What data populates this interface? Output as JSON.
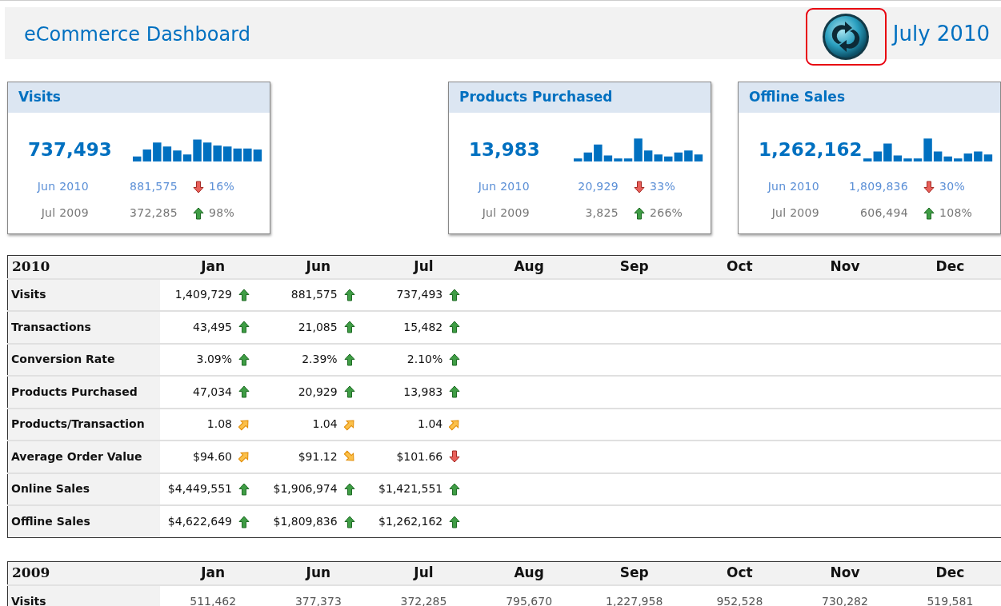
{
  "header": {
    "title": "eCommerce Dashboard",
    "refresh_highlighted": true,
    "period": "July 2010"
  },
  "cards": [
    {
      "title": "Visits",
      "value": "737,493",
      "comparisons": [
        {
          "color": "#5b8fd6",
          "label": "Jun 2010",
          "value": "881,575",
          "kind": "down",
          "change": "16%"
        },
        {
          "color": "#777777",
          "label": "Jul 2009",
          "value": "372,285",
          "kind": "up",
          "change": "98%"
        }
      ]
    },
    {
      "title": "Products Purchased",
      "value": "13,983",
      "comparisons": [
        {
          "color": "#5b8fd6",
          "label": "Jun 2010",
          "value": "20,929",
          "kind": "down",
          "change": "33%"
        },
        {
          "color": "#777777",
          "label": "Jul 2009",
          "value": "3,825",
          "kind": "up",
          "change": "266%"
        }
      ]
    },
    {
      "title": "Offline Sales",
      "value": "1,262,162",
      "comparisons": [
        {
          "color": "#5b8fd6",
          "label": "Jun 2010",
          "value": "1,809,836",
          "kind": "down",
          "change": "30%"
        },
        {
          "color": "#777777",
          "label": "Jul 2009",
          "value": "606,494",
          "kind": "up",
          "change": "108%"
        }
      ]
    }
  ],
  "tables": [
    {
      "year": "2010",
      "columns": [
        "Jan",
        "Jun",
        "Jul",
        "Aug",
        "Sep",
        "Oct",
        "Nov",
        "Dec"
      ],
      "rows": [
        {
          "label": "Visits",
          "cells": [
            {
              "value": "1,409,729",
              "kind": "up"
            },
            {
              "value": "881,575",
              "kind": "up"
            },
            {
              "value": "737,493",
              "kind": "up"
            }
          ]
        },
        {
          "label": "Transactions",
          "cells": [
            {
              "value": "43,495",
              "kind": "up"
            },
            {
              "value": "21,085",
              "kind": "up"
            },
            {
              "value": "15,482",
              "kind": "up"
            }
          ]
        },
        {
          "label": "Conversion Rate",
          "cells": [
            {
              "value": "3.09%",
              "kind": "up"
            },
            {
              "value": "2.39%",
              "kind": "up"
            },
            {
              "value": "2.10%",
              "kind": "up"
            }
          ]
        },
        {
          "label": "Products Purchased",
          "cells": [
            {
              "value": "47,034",
              "kind": "up"
            },
            {
              "value": "20,929",
              "kind": "up"
            },
            {
              "value": "13,983",
              "kind": "up"
            }
          ]
        },
        {
          "label": "Products/Transaction",
          "cells": [
            {
              "value": "1.08",
              "kind": "upright"
            },
            {
              "value": "1.04",
              "kind": "upright"
            },
            {
              "value": "1.04",
              "kind": "upright"
            }
          ]
        },
        {
          "label": "Average Order Value",
          "cells": [
            {
              "value": "$94.60",
              "kind": "upright"
            },
            {
              "value": "$91.12",
              "kind": "downright"
            },
            {
              "value": "$101.66",
              "kind": "down"
            }
          ]
        },
        {
          "label": "Online Sales",
          "cells": [
            {
              "value": "$4,449,551",
              "kind": "up"
            },
            {
              "value": "$1,906,974",
              "kind": "up"
            },
            {
              "value": "$1,421,551",
              "kind": "up"
            }
          ]
        },
        {
          "label": "Offline Sales",
          "cells": [
            {
              "value": "$4,622,649",
              "kind": "up"
            },
            {
              "value": "$1,809,836",
              "kind": "up"
            },
            {
              "value": "$1,262,162",
              "kind": "up"
            }
          ]
        }
      ]
    },
    {
      "year": "2009",
      "columns": [
        "Jan",
        "Jun",
        "Jul",
        "Aug",
        "Sep",
        "Oct",
        "Nov",
        "Dec"
      ],
      "rows": [
        {
          "label": "Visits",
          "cells": [
            {
              "value": "511,462"
            },
            {
              "value": "377,373"
            },
            {
              "value": "372,285"
            },
            {
              "value": "795,670"
            },
            {
              "value": "1,227,958"
            },
            {
              "value": "952,528"
            },
            {
              "value": "730,282"
            },
            {
              "value": "519,581"
            }
          ]
        }
      ]
    }
  ]
}
